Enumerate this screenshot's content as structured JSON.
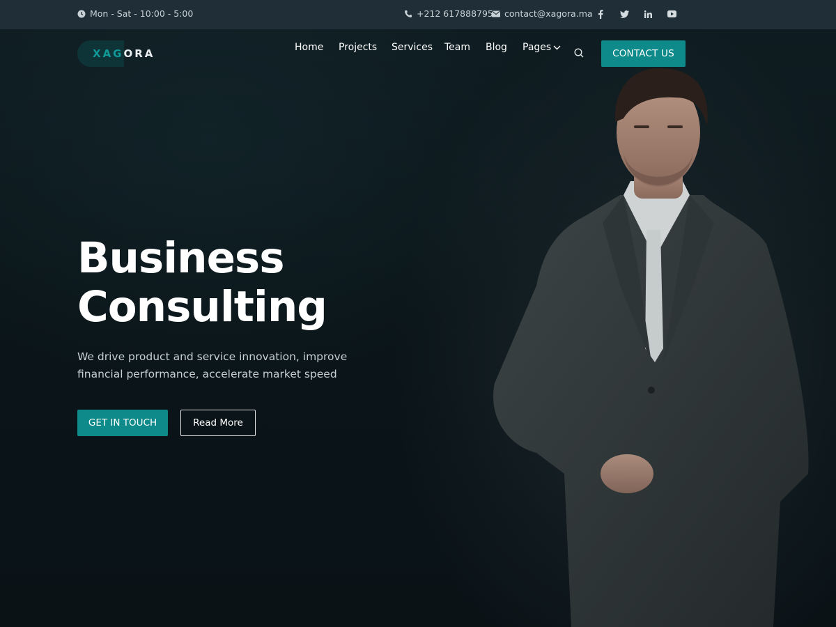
{
  "topbar": {
    "hours": "Mon - Sat - 10:00 - 5:00",
    "phone": "+212 617888795",
    "email": "contact@xagora.ma",
    "social": [
      "facebook-icon",
      "twitter-icon",
      "linkedin-icon",
      "youtube-icon"
    ]
  },
  "logo": {
    "part1": "XAG",
    "part2": "ORA"
  },
  "nav": {
    "items": [
      "Home",
      "Projects",
      "Services",
      "Team",
      "Blog",
      "Pages"
    ],
    "contact_label": "CONTACT US"
  },
  "hero": {
    "title_line1": "Business",
    "title_line2": "Consulting",
    "subtitle": "We drive product and service innovation, improve financial performance, accelerate market speed",
    "primary_cta": "GET IN TOUCH",
    "secondary_cta": "Read More"
  },
  "colors": {
    "accent": "#0f8a8a",
    "topbar_bg": "#1f2e37",
    "hero_bg": "#0b161a"
  }
}
